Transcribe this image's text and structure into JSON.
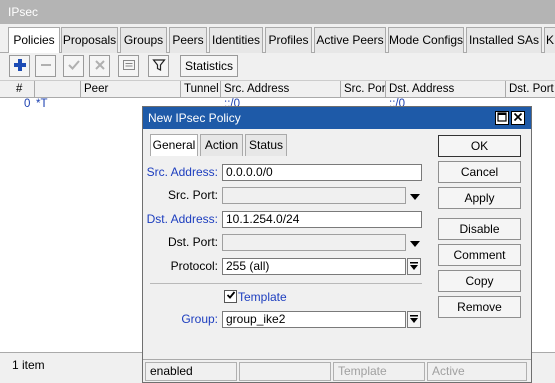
{
  "window": {
    "title": "IPsec"
  },
  "tabs": [
    {
      "label": "Policies",
      "active": true
    },
    {
      "label": "Proposals"
    },
    {
      "label": "Groups"
    },
    {
      "label": "Peers"
    },
    {
      "label": "Identities"
    },
    {
      "label": "Profiles"
    },
    {
      "label": "Active Peers"
    },
    {
      "label": "Mode Configs"
    },
    {
      "label": "Installed SAs"
    },
    {
      "label": "K"
    }
  ],
  "toolbar": {
    "icons": [
      "add-icon",
      "remove-icon",
      "enable-icon",
      "disable-icon",
      "comment-icon",
      "filter-icon"
    ],
    "statistics_label": "Statistics"
  },
  "grid": {
    "columns": [
      "#",
      "Peer",
      "Tunnel",
      "Src. Address",
      "Src. Port",
      "Dst. Address",
      "Dst. Port"
    ],
    "rows": [
      {
        "num": "0",
        "flag": "*T",
        "src": "::/0",
        "dst": "::/0"
      }
    ]
  },
  "statusbar": {
    "count": "1 item"
  },
  "dialog": {
    "title": "New IPsec Policy",
    "tabs": [
      "General",
      "Action",
      "Status"
    ],
    "active_tab": "General",
    "fields": {
      "src_address": {
        "label": "Src. Address:",
        "value": "0.0.0.0/0"
      },
      "src_port": {
        "label": "Src. Port:",
        "value": ""
      },
      "dst_address": {
        "label": "Dst. Address:",
        "value": "10.1.254.0/24"
      },
      "dst_port": {
        "label": "Dst. Port:",
        "value": ""
      },
      "protocol": {
        "label": "Protocol:",
        "value": "255 (all)"
      },
      "template": {
        "label": "Template",
        "checked": true
      },
      "group": {
        "label": "Group:",
        "value": "group_ike2"
      }
    },
    "buttons": {
      "ok": "OK",
      "cancel": "Cancel",
      "apply": "Apply",
      "disable": "Disable",
      "comment": "Comment",
      "copy": "Copy",
      "remove": "Remove"
    },
    "status": {
      "state": "enabled",
      "flag": "Template",
      "active": "Active"
    }
  },
  "colors": {
    "title_bar": "#1e5aa8",
    "label_blue": "#1d3ebf",
    "add_icon": "#1c4bb4"
  }
}
